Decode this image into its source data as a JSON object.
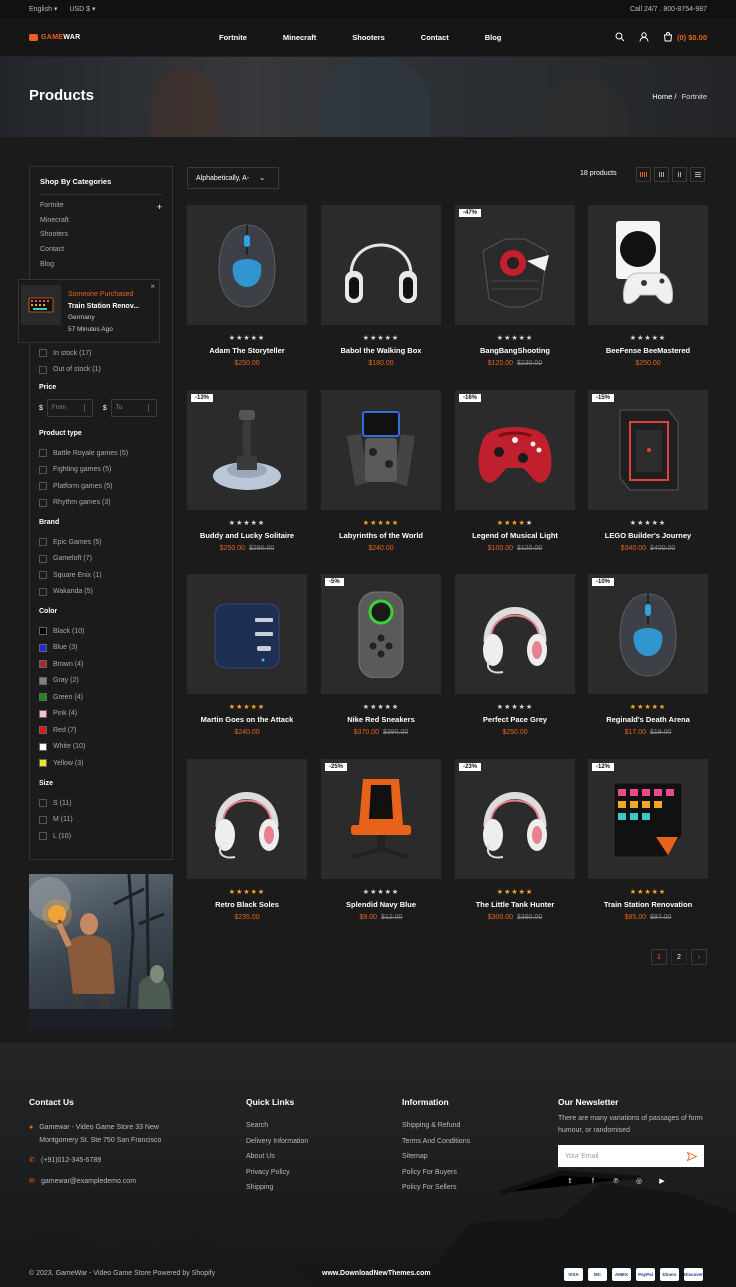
{
  "topbar": {
    "language": "English",
    "currency": "USD $",
    "call": "Call 24/7 . 800-8754-987"
  },
  "header": {
    "logo": {
      "accent": "GAME",
      "rest": "WAR",
      "tagline": "FIGHT YOUR GAMES"
    },
    "nav": [
      "Fortnite",
      "Minecraft",
      "Shooters",
      "Contact",
      "Blog"
    ],
    "cart": "(0) $0.00"
  },
  "hero": {
    "title": "Products",
    "breadcrumb_home": "Home",
    "breadcrumb_sep": "/",
    "breadcrumb_current": "Fortnite"
  },
  "sidebar": {
    "categories_title": "Shop By Categories",
    "categories": [
      "Fortnite",
      "Minecraft",
      "Shooters",
      "Contact",
      "Blog"
    ],
    "availability": [
      "In stock (17)",
      "Out of stock (1)"
    ],
    "price_title": "Price",
    "currency_symbol": "$",
    "price_from": "From",
    "price_to": "To",
    "product_type_title": "Product type",
    "product_types": [
      "Battle Royale games (5)",
      "Fighting games (5)",
      "Platform games (5)",
      "Rhythm games (3)"
    ],
    "brand_title": "Brand",
    "brands": [
      "Epic Games (5)",
      "Gameloft (7)",
      "Square Enix (1)",
      "Wakanda (5)"
    ],
    "color_title": "Color",
    "colors": [
      {
        "label": "Black (10)",
        "hex": "#000000"
      },
      {
        "label": "Blue (3)",
        "hex": "#1e2bd9"
      },
      {
        "label": "Brown (4)",
        "hex": "#a52a2a"
      },
      {
        "label": "Gray (2)",
        "hex": "#808080"
      },
      {
        "label": "Green (4)",
        "hex": "#1a8a1a"
      },
      {
        "label": "Pink (4)",
        "hex": "#ffc0cb"
      },
      {
        "label": "Red (7)",
        "hex": "#e01515"
      },
      {
        "label": "White (10)",
        "hex": "#ffffff"
      },
      {
        "label": "Yellow (3)",
        "hex": "#f5e61a"
      }
    ],
    "size_title": "Size",
    "sizes": [
      "S (11)",
      "M (11)",
      "L (10)"
    ]
  },
  "popup": {
    "line1": "Someone Purchased",
    "product": "Train Station Renov...",
    "location": "Germany",
    "time": "57 Minutes Ago"
  },
  "toolbar": {
    "sort": "Alphabetically, A-",
    "count": "18 products"
  },
  "products": [
    {
      "title": "Adam The Storyteller",
      "price": "$250.00",
      "old": "",
      "badge": "",
      "rating": 0,
      "icon": "mouse-icon"
    },
    {
      "title": "Babol the Walking Box",
      "price": "$180.00",
      "old": "",
      "badge": "",
      "rating": 0,
      "icon": "headphones-icon"
    },
    {
      "title": "BangBangShooting",
      "price": "$120.00",
      "old": "$230.00",
      "badge": "-47%",
      "rating": 0,
      "icon": "gamepad-grip-icon"
    },
    {
      "title": "BeeFense BeeMastered",
      "price": "$250.00",
      "old": "",
      "badge": "",
      "rating": 0,
      "icon": "console-icon"
    },
    {
      "title": "Buddy and Lucky Solitaire",
      "price": "$250.00",
      "old": "$290.00",
      "badge": "-13%",
      "rating": 0,
      "icon": "joystick-icon"
    },
    {
      "title": "Labyrinths of the World",
      "price": "$240.00",
      "old": "",
      "badge": "",
      "rating": 5,
      "icon": "phone-controller-icon"
    },
    {
      "title": "Legend of Musical Light",
      "price": "$100.00",
      "old": "$120.00",
      "badge": "-16%",
      "rating": 4,
      "icon": "gamepad-icon"
    },
    {
      "title": "LEGO Builder's Journey",
      "price": "$340.00",
      "old": "$400.00",
      "badge": "-15%",
      "rating": 0,
      "icon": "pc-case-icon"
    },
    {
      "title": "Martin Goes on the Attack",
      "price": "$240.00",
      "old": "",
      "badge": "",
      "rating": 5,
      "icon": "charger-icon"
    },
    {
      "title": "Nike Red Sneakers",
      "price": "$370.00",
      "old": "$390.00",
      "badge": "-5%",
      "rating": 0,
      "icon": "joycon-icon"
    },
    {
      "title": "Perfect Pace Grey",
      "price": "$250.00",
      "old": "",
      "badge": "",
      "rating": 0,
      "icon": "headset-icon"
    },
    {
      "title": "Reginald's Death Arena",
      "price": "$17.00",
      "old": "$19.00",
      "badge": "-10%",
      "rating": 5,
      "icon": "mouse-icon"
    },
    {
      "title": "Retro Black Soles",
      "price": "$235.00",
      "old": "",
      "badge": "",
      "rating": 5,
      "icon": "headset-icon"
    },
    {
      "title": "Splendid Navy Blue",
      "price": "$9.00",
      "old": "$12.00",
      "badge": "-25%",
      "rating": 0,
      "icon": "chair-icon"
    },
    {
      "title": "The Little Tank Hunter",
      "price": "$300.00",
      "old": "$390.00",
      "badge": "-23%",
      "rating": 5,
      "icon": "headset-icon"
    },
    {
      "title": "Train Station Renovation",
      "price": "$85.00",
      "old": "$97.00",
      "badge": "-12%",
      "rating": 5,
      "icon": "keypad-icon"
    }
  ],
  "pagination": [
    "1",
    "2",
    "›"
  ],
  "footer": {
    "contact_title": "Contact Us",
    "address": "Gamewar - Video Game Store 33 New Montgomery St. Ste 750 San Francisco",
    "phone": "(+91)012-345-6789",
    "email": "gamewar@exampledemo.com",
    "quick_title": "Quick Links",
    "quick_links": [
      "Search",
      "Delivery Information",
      "About Us",
      "Privacy Policy",
      "Shipping"
    ],
    "info_title": "Information",
    "info_links": [
      "Shipping & Refund",
      "Terms And Conditions",
      "Sitemap",
      "Policy For Buyers",
      "Policy For Sellers"
    ],
    "news_title": "Our Newsletter",
    "news_text": "There are many variations of passages of form humour, or randomised",
    "news_placeholder": "Your Email",
    "socials": [
      "twitter-icon",
      "facebook-icon",
      "pinterest-icon",
      "instagram-icon",
      "youtube-icon"
    ],
    "copyright": "© 2023, GameWar - Video Game Store Powered by Shopify",
    "download": "www.DownloadNewThemes.com",
    "payments": [
      "VISA",
      "MC",
      "AMEX",
      "PayPal",
      "Diners",
      "Discover"
    ]
  },
  "colors": {
    "accent": "#e8621a",
    "background": "#1b1b1b",
    "star": "#f5a623"
  }
}
